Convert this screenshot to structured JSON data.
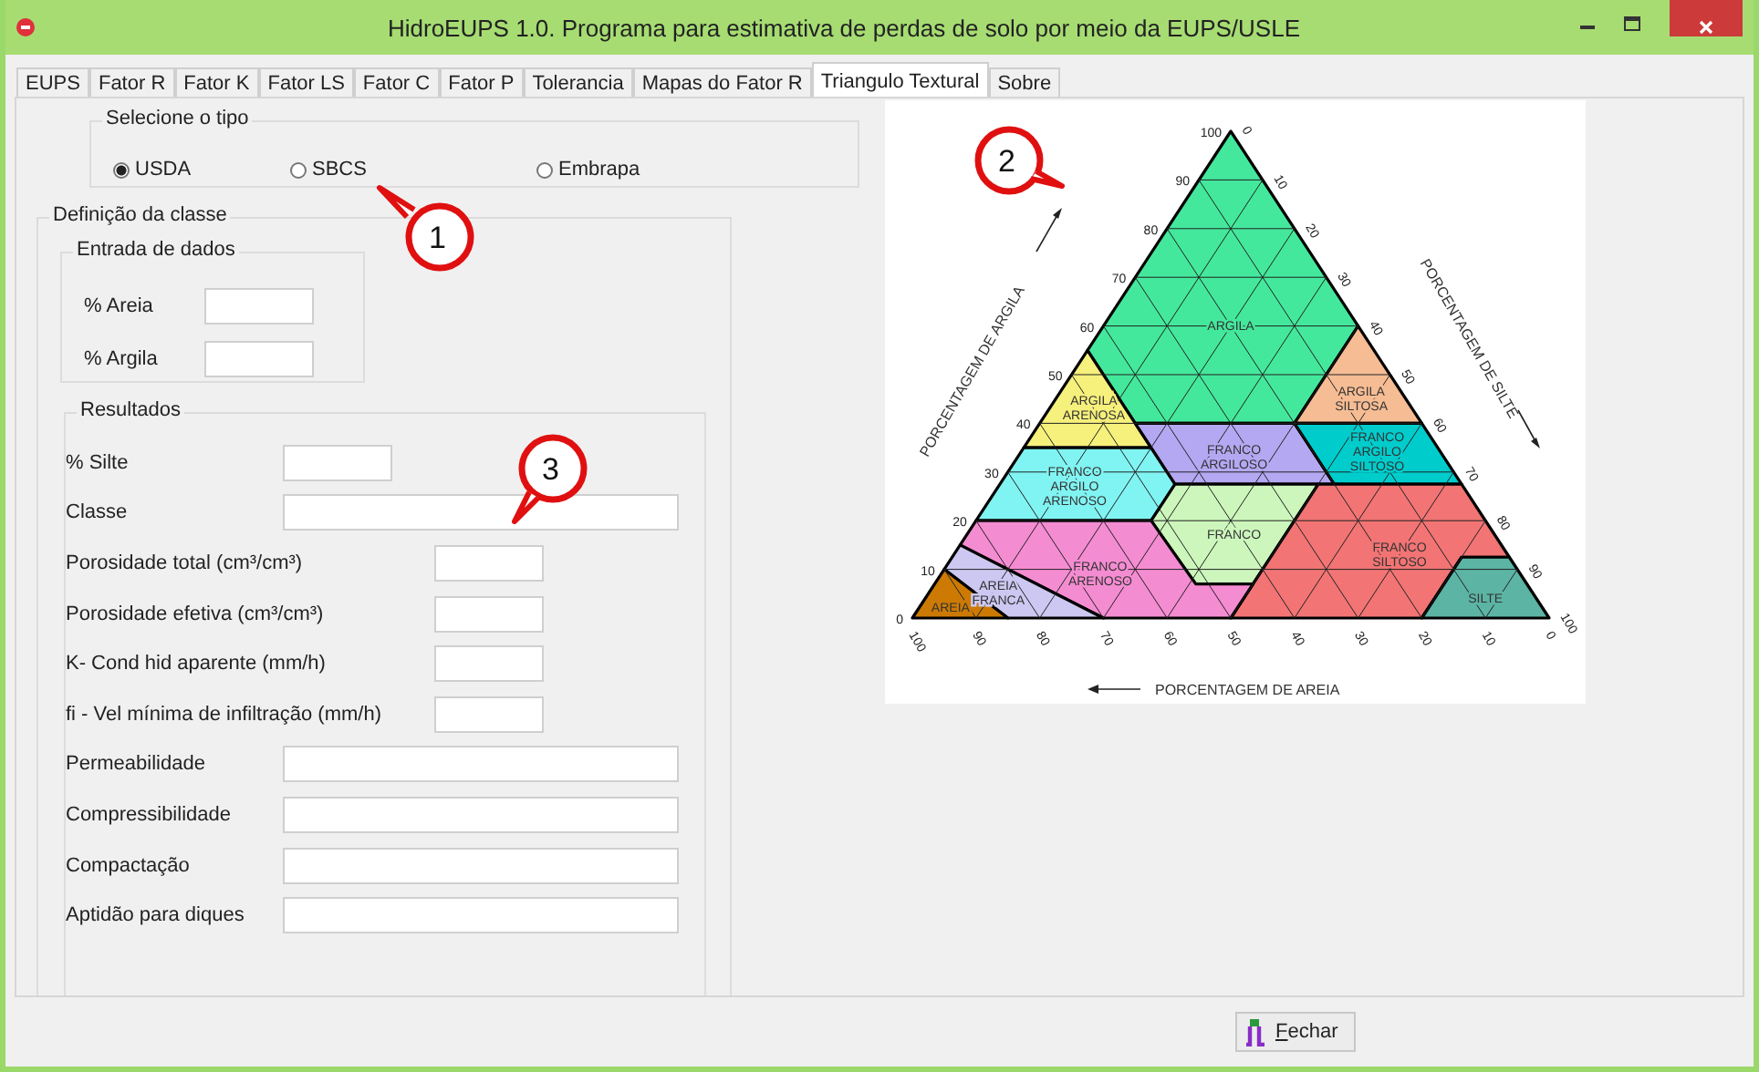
{
  "window": {
    "title": "HidroEUPS 1.0.  Programa para estimativa de perdas de solo por meio da EUPS/USLE"
  },
  "tabs": [
    {
      "label": "EUPS",
      "selected": false
    },
    {
      "label": "Fator R",
      "selected": false
    },
    {
      "label": "Fator K",
      "selected": false
    },
    {
      "label": "Fator LS",
      "selected": false
    },
    {
      "label": "Fator C",
      "selected": false
    },
    {
      "label": "Fator P",
      "selected": false
    },
    {
      "label": "Tolerancia",
      "selected": false
    },
    {
      "label": "Mapas do Fator R",
      "selected": false
    },
    {
      "label": "Triangulo Textural",
      "selected": true
    },
    {
      "label": "Sobre",
      "selected": false
    }
  ],
  "type_group": {
    "title": "Selecione o tipo",
    "options": [
      {
        "label": "USDA",
        "selected": true
      },
      {
        "label": "SBCS",
        "selected": false
      },
      {
        "label": "Embrapa",
        "selected": false
      }
    ]
  },
  "class_group": {
    "title": "Definição da classe",
    "input_group": {
      "title": "Entrada de dados",
      "fields": [
        {
          "label": "% Areia"
        },
        {
          "label": "% Argila"
        }
      ]
    },
    "results": {
      "title": "Resultados",
      "fields": [
        {
          "label": "% Silte",
          "kind": "short"
        },
        {
          "label": "Classe",
          "kind": "wide"
        },
        {
          "label": "Porosidade total (cm³/cm³)",
          "kind": "offset"
        },
        {
          "label": "Porosidade efetiva (cm³/cm³)",
          "kind": "offset"
        },
        {
          "label": "K- Cond hid aparente (mm/h)",
          "kind": "offset"
        },
        {
          "label": "fi - Vel  mínima de infiltração (mm/h)",
          "kind": "offset"
        },
        {
          "label": "Permeabilidade",
          "kind": "wide"
        },
        {
          "label": "Compressibilidade",
          "kind": "wide"
        },
        {
          "label": "Compactação",
          "kind": "wide"
        },
        {
          "label": "Aptidão para diques",
          "kind": "wide"
        }
      ]
    }
  },
  "triangle": {
    "regions": [
      {
        "label": [
          "ARGILA"
        ],
        "color": "#44e89c"
      },
      {
        "label": [
          "ARGILA",
          "ARENOSA"
        ],
        "color": "#f6f07c"
      },
      {
        "label": [
          "ARGILA",
          "SILTOSA"
        ],
        "color": "#f6bc94"
      },
      {
        "label": [
          "FRANCO",
          "ARGILO",
          "ARENOSO"
        ],
        "color": "#80f4f2"
      },
      {
        "label": [
          "FRANCO",
          "ARGILOSO"
        ],
        "color": "#b4a8f2"
      },
      {
        "label": [
          "FRANCO",
          "ARGILO",
          "SILTOSO"
        ],
        "color": "#00cccc"
      },
      {
        "label": [
          "FRANCO"
        ],
        "color": "#ccf6bc"
      },
      {
        "label": [
          "FRANCO",
          "SILTOSO"
        ],
        "color": "#f27474"
      },
      {
        "label": [
          "SILTE"
        ],
        "color": "#5cb4a4"
      },
      {
        "label": [
          "FRANCO",
          "ARENOSO"
        ],
        "color": "#f48cd2"
      },
      {
        "label": [
          "AREIA",
          "FRANCA"
        ],
        "color": "#ccc8f2"
      },
      {
        "label": [
          "AREIA"
        ],
        "color": "#cc7a04"
      }
    ],
    "clay_ticks": [
      "0",
      "10",
      "20",
      "30",
      "40",
      "50",
      "60",
      "70",
      "80",
      "90",
      "100"
    ],
    "silt_ticks": [
      "0",
      "10",
      "20",
      "30",
      "40",
      "50",
      "60",
      "70",
      "80",
      "90",
      "100"
    ],
    "sand_ticks": [
      "100",
      "90",
      "80",
      "70",
      "60",
      "50",
      "40",
      "30",
      "20",
      "10",
      "0"
    ],
    "clay_axis": "PORCENTAGEM DE ARGILA",
    "silt_axis": "PORCENTAGEM DE SILTE",
    "sand_axis": "PORCENTAGEM DE AREIA"
  },
  "callouts": [
    "1",
    "2",
    "3"
  ],
  "close_button": {
    "label": "Fechar"
  }
}
